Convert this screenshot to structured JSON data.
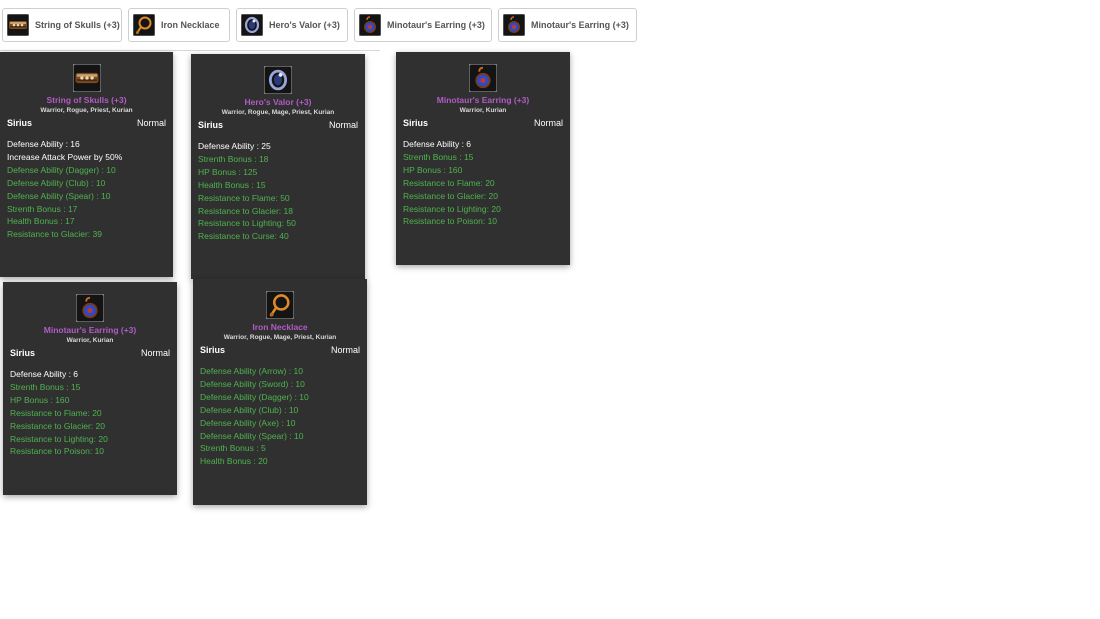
{
  "tabs": [
    {
      "label": "String of Skulls (+3)",
      "icon": "skull-string-icon"
    },
    {
      "label": "Iron Necklace",
      "icon": "necklace-icon"
    },
    {
      "label": "Hero's Valor (+3)",
      "icon": "ring-icon"
    },
    {
      "label": "Minotaur's Earring (+3)",
      "icon": "earring-icon"
    },
    {
      "label": "Minotaur's Earring (+3)",
      "icon": "earring-icon"
    }
  ],
  "cards": [
    {
      "name": "String of Skulls (+3)",
      "classes": "Warrior, Rogue, Priest, Kurian",
      "server": "Sirius",
      "grade": "Normal",
      "icon": "skull-string-icon",
      "stats_white": [
        "Defense Ability : 16",
        "Increase Attack Power by 50%"
      ],
      "stats_green": [
        "Defense Ability (Dagger) : 10",
        "Defense Ability (Club) : 10",
        "Defense Ability (Spear) : 10",
        "Strenth Bonus : 17",
        "Health Bonus : 17",
        "Resistance to Glacier: 39"
      ]
    },
    {
      "name": "Hero's Valor (+3)",
      "classes": "Warrior, Rogue, Mage, Priest, Kurian",
      "server": "Sirius",
      "grade": "Normal",
      "icon": "ring-icon",
      "stats_white": [
        "Defense Ability : 25"
      ],
      "stats_green": [
        "Strenth Bonus : 18",
        "HP Bonus : 125",
        "Health Bonus : 15",
        "Resistance to Flame: 50",
        "Resistance to Glacier: 18",
        "Resistance to Lighting: 50",
        "Resistance to Curse: 40"
      ]
    },
    {
      "name": "Minotaur's Earring (+3)",
      "classes": "Warrior, Kurian",
      "server": "Sirius",
      "grade": "Normal",
      "icon": "earring-icon",
      "stats_white": [
        "Defense Ability : 6"
      ],
      "stats_green": [
        "Strenth Bonus : 15",
        "HP Bonus : 160",
        "Resistance to Flame: 20",
        "Resistance to Glacier: 20",
        "Resistance to Lighting: 20",
        "Resistance to Poison: 10"
      ]
    },
    {
      "name": "Minotaur's Earring (+3)",
      "classes": "Warrior, Kurian",
      "server": "Sirius",
      "grade": "Normal",
      "icon": "earring-icon",
      "stats_white": [
        "Defense Ability : 6"
      ],
      "stats_green": [
        "Strenth Bonus : 15",
        "HP Bonus : 160",
        "Resistance to Flame: 20",
        "Resistance to Glacier: 20",
        "Resistance to Lighting: 20",
        "Resistance to Poison: 10"
      ]
    },
    {
      "name": "Iron Necklace",
      "classes": "Warrior, Rogue, Mage, Priest, Kurian",
      "server": "Sirius",
      "grade": "Normal",
      "icon": "necklace-icon",
      "stats_white": [],
      "stats_green": [
        "Defense Ability (Arrow) : 10",
        "Defense Ability (Sword) : 10",
        "Defense Ability (Dagger) : 10",
        "Defense Ability (Club) : 10",
        "Defense Ability (Axe) : 10",
        "Defense Ability (Spear) : 10",
        "Strenth Bonus : 5",
        "Health Bonus : 20"
      ]
    }
  ]
}
